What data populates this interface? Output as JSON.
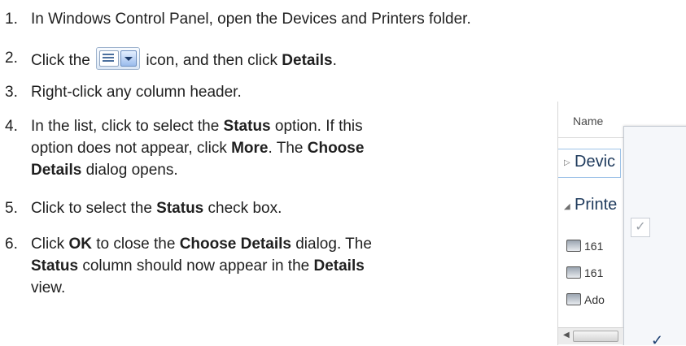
{
  "steps": [
    {
      "num": "1.",
      "lines": [
        [
          "In Windows Control Panel, open the Devices and Printers folder."
        ]
      ]
    },
    {
      "num": "2.",
      "pre": "Click the",
      "icon": "view-options-icon",
      "mid": " icon, and then click ",
      "bold": "Details",
      "post": "."
    },
    {
      "num": "3.",
      "text": "Right-click any column header."
    },
    {
      "num": "4.",
      "l1a": "In the list, click to select the ",
      "l1b": "Status",
      "l1c": " option. If this",
      "l2a": "option does not appear, click ",
      "l2b": "More",
      "l2c": ". The ",
      "l2d": "Choose",
      "l3a": "Details",
      "l3b": " dialog opens."
    },
    {
      "num": "5.",
      "a": "Click to select the ",
      "b": "Status",
      "c": " check box."
    },
    {
      "num": "6.",
      "l1a": "Click ",
      "l1b": "OK",
      "l1c": " to close the ",
      "l1d": "Choose Details",
      "l1e": " dialog. The",
      "l2a": "Status",
      "l2b": " column should now appear in the ",
      "l2c": "Details",
      "l3a": "view."
    }
  ],
  "thumbnail": {
    "header": "Name",
    "groups": [
      "Devic",
      "Printe"
    ],
    "items": [
      "161",
      "161",
      "Ado"
    ],
    "checks": [
      "✓",
      "✓"
    ]
  }
}
